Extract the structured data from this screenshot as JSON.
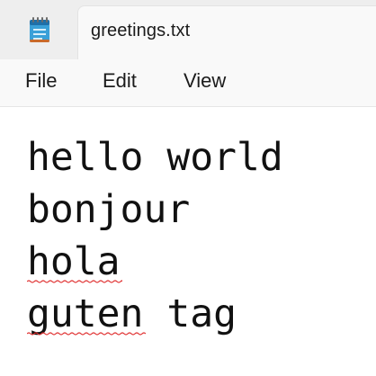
{
  "tab": {
    "title": "greetings.txt",
    "icon": "notepad-icon"
  },
  "menu": {
    "file": "File",
    "edit": "Edit",
    "view": "View"
  },
  "editor": {
    "lines": [
      "hello world",
      "bonjour",
      "hola",
      "guten tag"
    ],
    "spellcheck_color": "#e03131"
  },
  "colors": {
    "titlebar": "#eeeeee",
    "tab": "#f9f9f9",
    "text": "#111111"
  }
}
